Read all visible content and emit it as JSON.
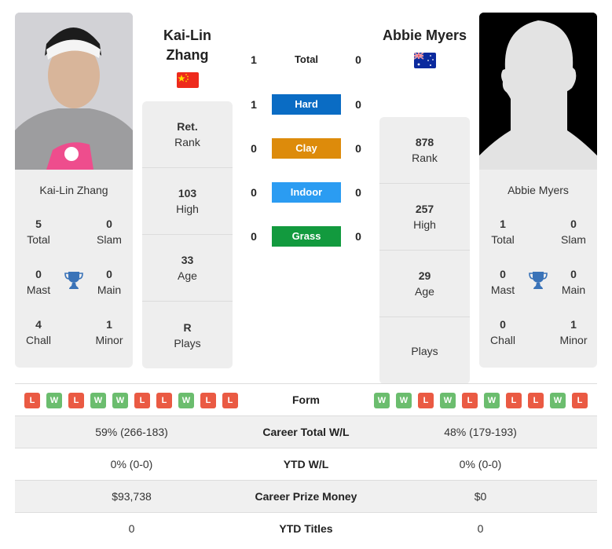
{
  "colors": {
    "hard": "#0a6cc4",
    "clay": "#dd8b0b",
    "indoor": "#2b9cf2",
    "grass": "#129a3e",
    "win": "#6bbd6e",
    "loss": "#ea5a43",
    "trophy": "#3a73b8"
  },
  "player1": {
    "name": "Kai-Lin Zhang",
    "name_line1": "Kai-Lin",
    "name_line2": "Zhang",
    "flag": "china-flag-icon",
    "photo": "player-photo",
    "titles": {
      "total": {
        "value": "5",
        "label": "Total"
      },
      "slam": {
        "value": "0",
        "label": "Slam"
      },
      "mast": {
        "value": "0",
        "label": "Mast"
      },
      "main": {
        "value": "0",
        "label": "Main"
      },
      "chall": {
        "value": "4",
        "label": "Chall"
      },
      "minor": {
        "value": "1",
        "label": "Minor"
      }
    },
    "stats": {
      "rank": {
        "value": "Ret.",
        "label": "Rank"
      },
      "high": {
        "value": "103",
        "label": "High"
      },
      "age": {
        "value": "33",
        "label": "Age"
      },
      "plays": {
        "value": "R",
        "label": "Plays"
      }
    },
    "form": [
      "L",
      "W",
      "L",
      "W",
      "W",
      "L",
      "L",
      "W",
      "L",
      "L"
    ]
  },
  "player2": {
    "name": "Abbie Myers",
    "flag": "australia-flag-icon",
    "photo": "placeholder-silhouette",
    "titles": {
      "total": {
        "value": "1",
        "label": "Total"
      },
      "slam": {
        "value": "0",
        "label": "Slam"
      },
      "mast": {
        "value": "0",
        "label": "Mast"
      },
      "main": {
        "value": "0",
        "label": "Main"
      },
      "chall": {
        "value": "0",
        "label": "Chall"
      },
      "minor": {
        "value": "1",
        "label": "Minor"
      }
    },
    "stats": {
      "rank": {
        "value": "878",
        "label": "Rank"
      },
      "high": {
        "value": "257",
        "label": "High"
      },
      "age": {
        "value": "29",
        "label": "Age"
      },
      "plays": {
        "value": "",
        "label": "Plays"
      }
    },
    "form": [
      "W",
      "W",
      "L",
      "W",
      "L",
      "W",
      "L",
      "L",
      "W",
      "L"
    ]
  },
  "h2h": [
    {
      "label": "Total",
      "p1": "1",
      "p2": "0",
      "surface": "total"
    },
    {
      "label": "Hard",
      "p1": "1",
      "p2": "0",
      "surface": "hard"
    },
    {
      "label": "Clay",
      "p1": "0",
      "p2": "0",
      "surface": "clay"
    },
    {
      "label": "Indoor",
      "p1": "0",
      "p2": "0",
      "surface": "indoor"
    },
    {
      "label": "Grass",
      "p1": "0",
      "p2": "0",
      "surface": "grass"
    }
  ],
  "table": {
    "form_label": "Form",
    "rows": [
      {
        "label": "Career Total W/L",
        "p1": "59% (266-183)",
        "p2": "48% (179-193)"
      },
      {
        "label": "YTD W/L",
        "p1": "0% (0-0)",
        "p2": "0% (0-0)"
      },
      {
        "label": "Career Prize Money",
        "p1": "$93,738",
        "p2": "$0"
      },
      {
        "label": "YTD Titles",
        "p1": "0",
        "p2": "0"
      }
    ]
  }
}
